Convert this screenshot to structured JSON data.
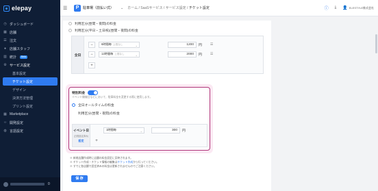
{
  "app": {
    "logo_text": "elepay"
  },
  "sidebar": {
    "items": [
      {
        "label": "ダッシュボード",
        "icon": "clock-icon"
      },
      {
        "label": "店舗",
        "icon": "store-icon"
      },
      {
        "label": "注文",
        "icon": "list-icon"
      },
      {
        "label": "店舗スタッフ",
        "icon": "person-icon"
      },
      {
        "label": "統計",
        "icon": "chart-icon",
        "badge": "Beta"
      }
    ],
    "section": {
      "label": "サービス設定",
      "icon": "gear-icon"
    },
    "sub_items": [
      {
        "label": "基本設定"
      },
      {
        "label": "チケット設定",
        "active": true
      },
      {
        "label": "デザイン"
      },
      {
        "label": "決済方法管理"
      },
      {
        "label": "プリント設定"
      }
    ],
    "bottom_items": [
      {
        "label": "Marketplace",
        "icon": "grid-icon"
      },
      {
        "label": "開発設定",
        "icon": "code-icon"
      },
      {
        "label": "言語設定",
        "icon": "globe-icon"
      }
    ],
    "footer_number": "0"
  },
  "header": {
    "badge": "P",
    "facility": "駐車場（前払い式）",
    "breadcrumb": [
      "ホーム",
      "SaaSサービス",
      "サービス設定",
      "チケット設定"
    ],
    "user": "ELESTYLE株式会社"
  },
  "content": {
    "option_night": "利用区分(昼間・夜間)の料金",
    "option_weekday": "利用区分(平日・土日祝)(昼間・夜間)の料金",
    "all_day_table": {
      "label": "全日",
      "rows": [
        {
          "duration": "6時間毎",
          "hint": "上限なし",
          "price": "1200",
          "unit": "円"
        },
        {
          "duration": "12時間毎",
          "hint": "上限なし",
          "price": "2000",
          "unit": "円"
        }
      ]
    },
    "special": {
      "title": "特別料金",
      "description": "イベント開催日などにおいて、駐車料金を変更する際に使用します。",
      "option_all_time": "全日オールタイムの料金",
      "option_day_night": "利用区分(昼間・夜間)の料金",
      "table": {
        "label": "イベント日",
        "sublabel": "(日程設定済み)",
        "link": "設定",
        "rows": [
          {
            "duration": "1時間毎",
            "price": "300",
            "unit": "円"
          }
        ]
      }
    },
    "notes": [
      "※ 新規店舗作成時に店舗の料金設定に反映されます。",
      "※ チケット作成・チケット情報の編集は",
      "チケット作成",
      "から行ってください。",
      "※ すでに各店舗で設定済みの料金は更新されませんのでご注意ください。"
    ],
    "save_label": "保 存"
  },
  "colors": {
    "accent": "#2f7bf0",
    "highlight": "#b0357a",
    "sidebar": "#0f1e36"
  }
}
